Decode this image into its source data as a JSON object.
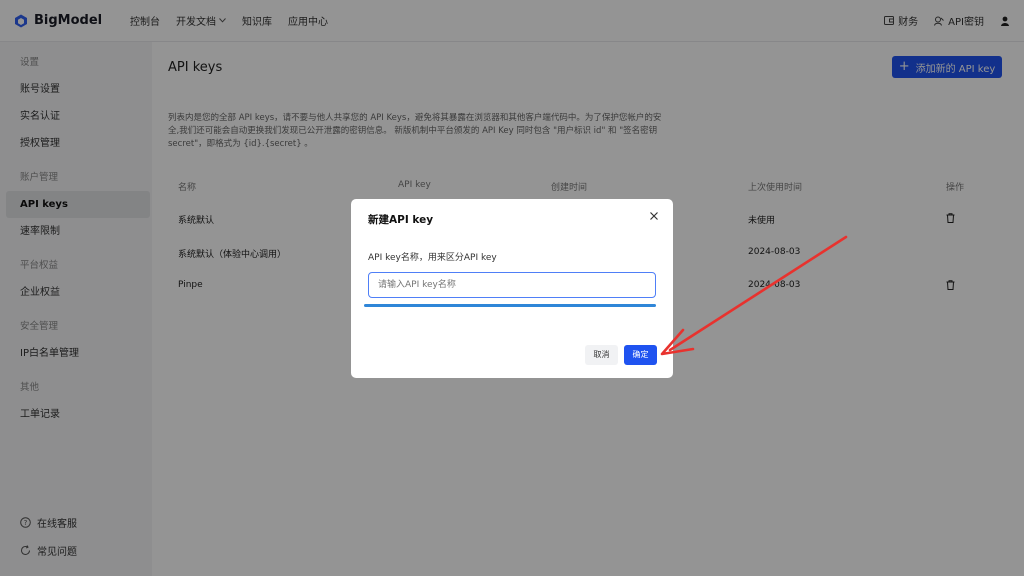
{
  "brand": {
    "name": "BigModel"
  },
  "topnav": {
    "items": [
      "控制台",
      "开发文档",
      "知识库",
      "应用中心"
    ]
  },
  "topright": {
    "finance": "财务",
    "api_keys": "API密钥"
  },
  "sidebar": {
    "groups": [
      {
        "title": "设置",
        "items": [
          "账号设置",
          "实名认证",
          "授权管理"
        ]
      },
      {
        "title": "账户管理",
        "items": [
          "API keys",
          "速率限制"
        ]
      },
      {
        "title": "平台权益",
        "items": [
          "企业权益"
        ]
      },
      {
        "title": "安全管理",
        "items": [
          "IP白名单管理"
        ]
      },
      {
        "title": "其他",
        "items": [
          "工单记录"
        ]
      }
    ],
    "active_item": "API keys",
    "bottom": [
      "在线客服",
      "常见问题"
    ]
  },
  "main": {
    "title": "API keys",
    "add_button": "添加新的 API key",
    "description": "列表内是您的全部 API keys，请不要与他人共享您的 API Keys，避免将其暴露在浏览器和其他客户端代码中。为了保护您帐户的安全,我们还可能会自动更换我们发现已公开泄露的密钥信息。 新版机制中平台颁发的 API Key 同时包含 \"用户标识 id\" 和 \"签名密钥 secret\"，即格式为 {id}.{secret} 。",
    "table": {
      "headers": [
        "名称",
        "API key",
        "创建时间",
        "上次使用时间",
        "操作"
      ],
      "rows": [
        {
          "name": "系统默认",
          "last_used": "未使用"
        },
        {
          "name": "系统默认（体验中心调用）",
          "last_used": "2024-08-03"
        },
        {
          "name": "Pinpe",
          "last_used": "2024-08-03"
        }
      ]
    }
  },
  "modal": {
    "title": "新建API key",
    "label": "API key名称，用来区分API key",
    "input_placeholder": "请输入API key名称",
    "input_value": "",
    "cancel": "取消",
    "confirm": "确定"
  },
  "colors": {
    "primary": "#1f53f0",
    "highlight_underline": "#2f86d8",
    "annotation_arrow": "#e8322e"
  }
}
